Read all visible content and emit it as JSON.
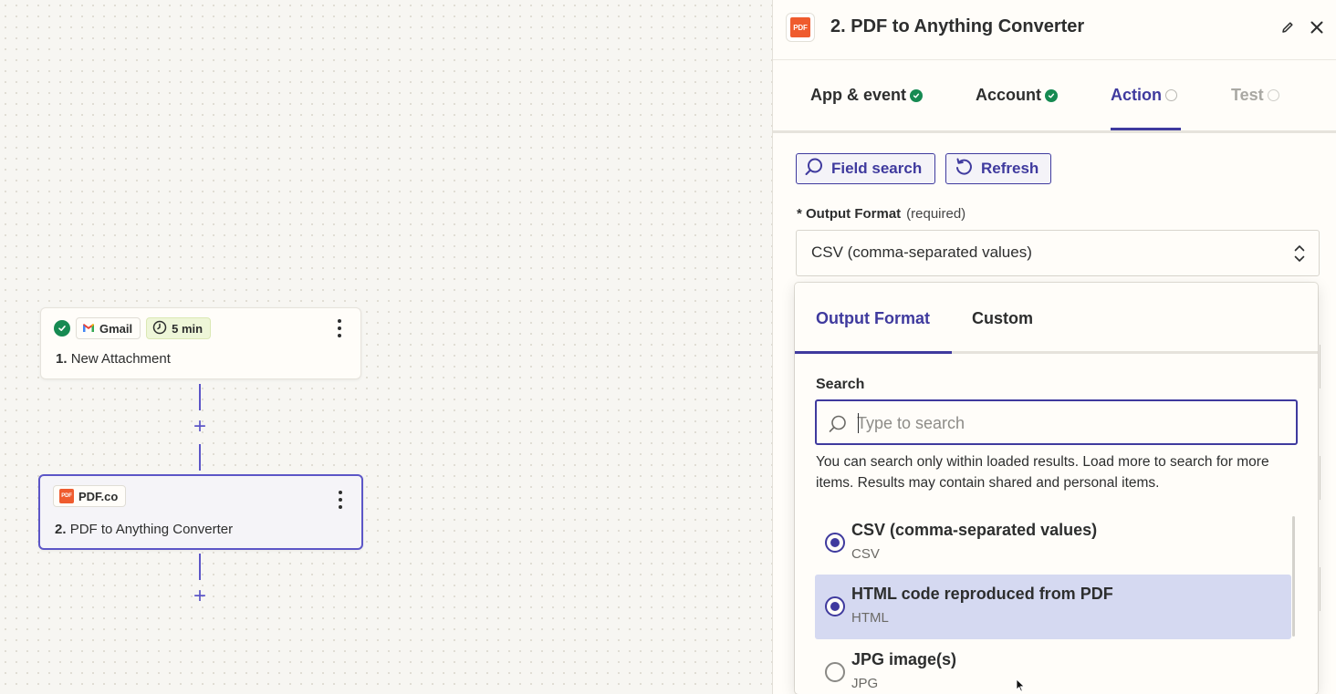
{
  "canvas": {
    "trigger_step": {
      "app_name": "Gmail",
      "poll_interval": "5 min",
      "number": "1.",
      "title": "New Attachment"
    },
    "action_step": {
      "app_name": "PDF.co",
      "number": "2.",
      "title": "PDF to Anything Converter"
    },
    "add_step_symbol": "+"
  },
  "panel": {
    "title": "2. PDF to Anything Converter",
    "tabs": [
      {
        "label": "App & event",
        "status": "complete"
      },
      {
        "label": "Account",
        "status": "complete"
      },
      {
        "label": "Action",
        "status": "pending"
      },
      {
        "label": "Test",
        "status": "disabled"
      }
    ],
    "toolbar": {
      "field_search_label": "Field search",
      "refresh_label": "Refresh"
    },
    "output_format": {
      "label": "* Output Format",
      "required_hint": "(required)",
      "selected_value": "CSV (comma-separated values)"
    }
  },
  "dropdown": {
    "tabs": [
      "Output Format",
      "Custom"
    ],
    "search_label": "Search",
    "search_placeholder": "Type to search",
    "help_text": "You can search only within loaded results. Load more to search for more items. Results may contain shared and personal items.",
    "options": [
      {
        "title": "CSV (comma-separated values)",
        "value": "CSV",
        "checked": true,
        "highlighted": false
      },
      {
        "title": "HTML code reproduced from PDF",
        "value": "HTML",
        "checked": true,
        "highlighted": true
      },
      {
        "title": "JPG image(s)",
        "value": "JPG",
        "checked": false,
        "highlighted": false
      }
    ]
  },
  "colors": {
    "accent": "#3f3a9e",
    "success": "#168a52",
    "pdf_brand": "#ef5b2e",
    "highlight": "#d5d9f1"
  }
}
